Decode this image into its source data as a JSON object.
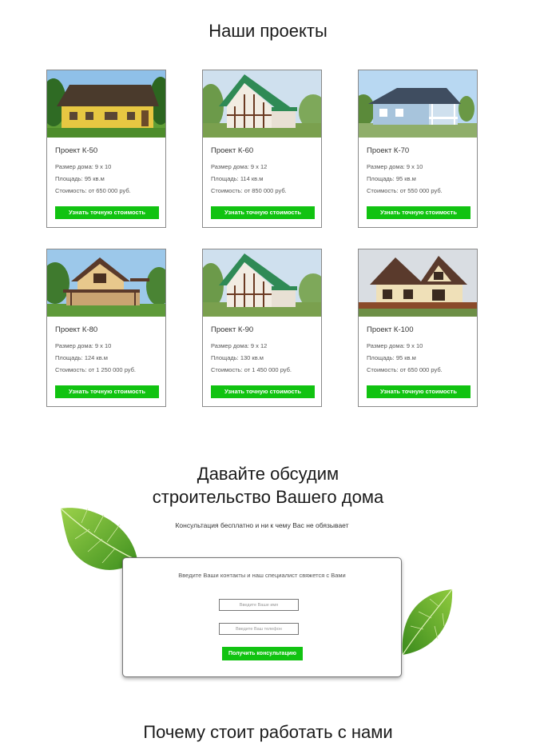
{
  "projects": {
    "title": "Наши проекты",
    "items": [
      {
        "name": "Проект К-50",
        "size": "Размер дома: 9 х 10",
        "area": "Площадь: 95 кв.м",
        "price": "Стоимость: от 650 000 руб.",
        "button": "Узнать точную стоимость",
        "photo": "yellow-one-storey-house-photo"
      },
      {
        "name": "Проект К-60",
        "size": "Размер дома: 9 х 12",
        "area": "Площадь: 114 кв.м",
        "price": "Стоимость: от 850 000 руб.",
        "button": "Узнать точную стоимость",
        "photo": "half-timbered-house-photo"
      },
      {
        "name": "Проект К-70",
        "size": "Размер дома: 9 х 10",
        "area": "Площадь: 95 кв.м",
        "price": "Стоимость: от 550 000 руб.",
        "button": "Узнать точную стоимость",
        "photo": "blue-house-with-veranda-photo"
      },
      {
        "name": "Проект К-80",
        "size": "Размер дома: 9 х 10",
        "area": "Площадь: 124 кв.м",
        "price": "Стоимость: от 1 250 000 руб.",
        "button": "Узнать точную стоимость",
        "photo": "two-storey-house-with-terrace-photo"
      },
      {
        "name": "Проект К-90",
        "size": "Размер дома: 9 х 12",
        "area": "Площадь: 130 кв.м",
        "price": "Стоимость: от 1 450 000 руб.",
        "button": "Узнать точную стоимость",
        "photo": "half-timbered-house-photo"
      },
      {
        "name": "Проект К-100",
        "size": "Размер дома: 9 х 10",
        "area": "Площадь: 95 кв.м",
        "price": "Стоимость: от 650 000 руб.",
        "button": "Узнать точную стоимость",
        "photo": "brown-roof-cottage-photo"
      }
    ]
  },
  "discuss": {
    "title_line1": "Давайте обсудим",
    "title_line2": "строительство Вашего дома",
    "subtitle": "Консультация бесплатно и ни к чему Вас не обязывает",
    "form": {
      "caption": "Введите Ваши контакты и наш специалист свяжется с Вами",
      "name_placeholder": "Введите Ваше имя",
      "phone_placeholder": "Введите Ваш телефон",
      "submit": "Получить консультацию"
    }
  },
  "why": {
    "title": "Почему стоит работать с нами"
  },
  "colors": {
    "accent_green": "#11c311",
    "card_border": "#8a8a8a"
  }
}
